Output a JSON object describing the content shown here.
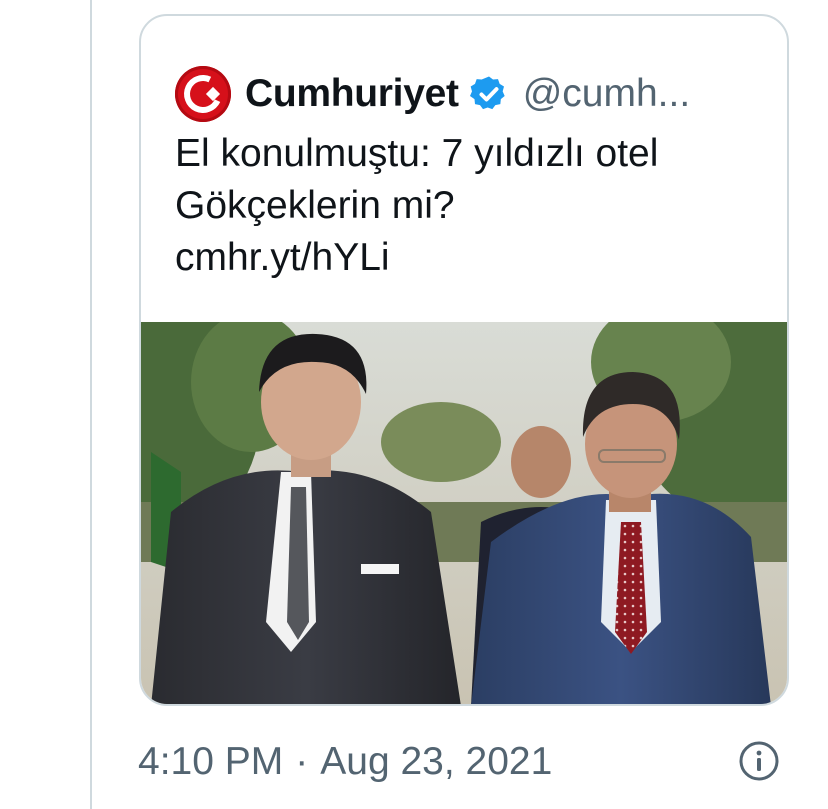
{
  "quoted_tweet": {
    "display_name": "Cumhuriyet",
    "handle": "@cumh...",
    "verified": true,
    "text_lines": [
      "El konulmuştu: 7 yıldızlı otel",
      "Gökçeklerin mi?"
    ],
    "link": "cmhr.yt/hYLi",
    "avatar_icon": "cumhuriyet-logo",
    "media_icon": "photo-two-men-in-suits"
  },
  "tweet_meta": {
    "time": "4:10 PM",
    "separator": "·",
    "date": "Aug 23, 2021",
    "info_icon": "info-icon"
  },
  "colors": {
    "text": "#0f1419",
    "secondary": "#536471",
    "border": "#cfd9de",
    "verified_blue": "#1d9bf0",
    "brand_red": "#d6101a"
  }
}
